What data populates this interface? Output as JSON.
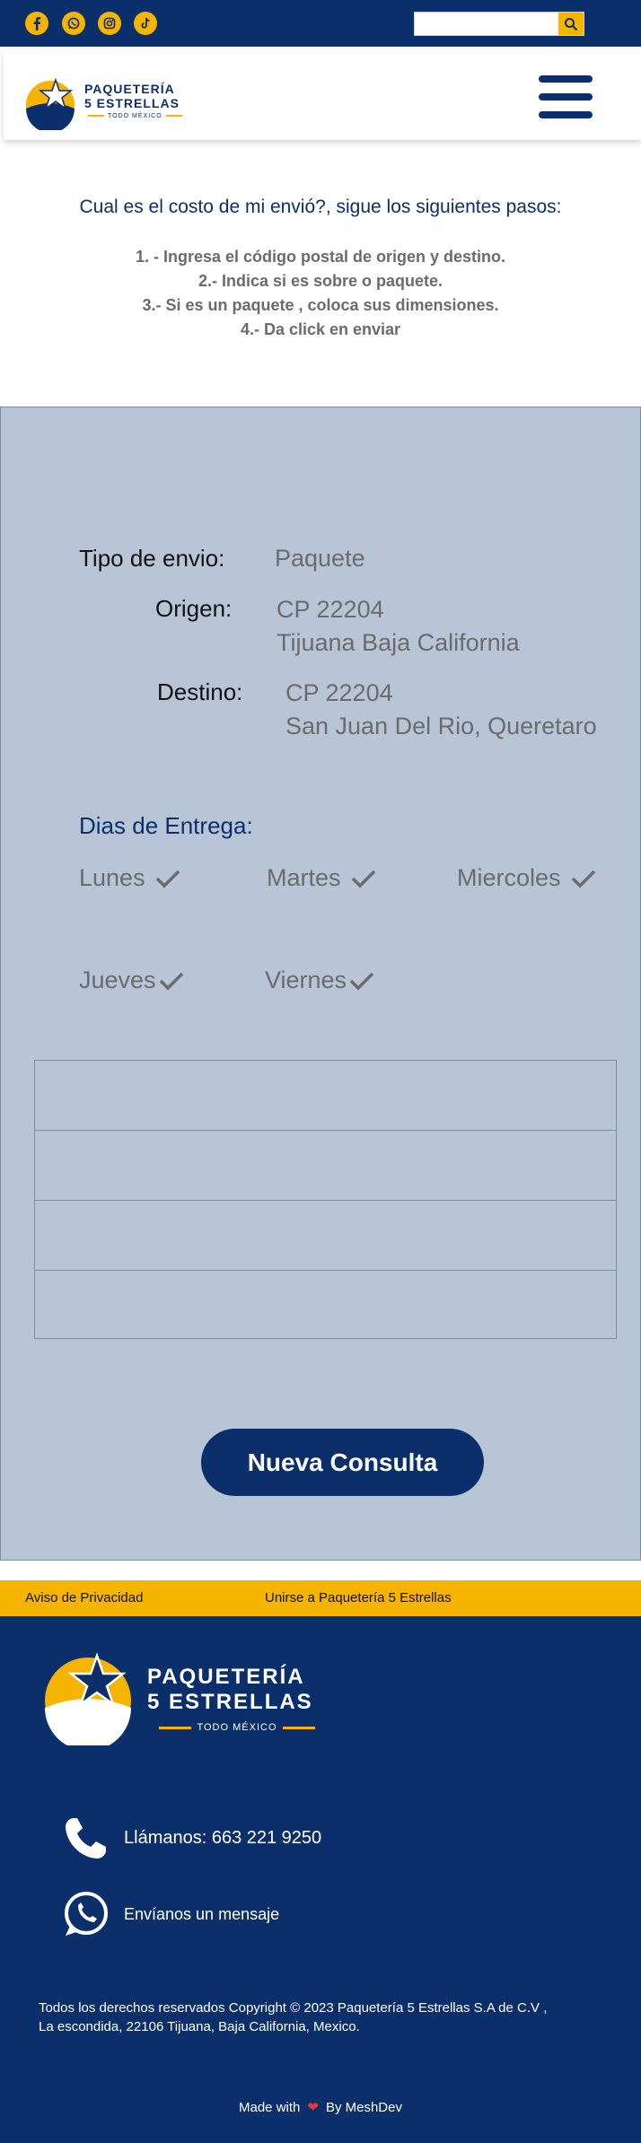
{
  "search": {
    "placeholder": "",
    "button_icon": "search-icon"
  },
  "social": [
    "facebook-icon",
    "whatsapp-icon",
    "instagram-icon",
    "tiktok-icon"
  ],
  "brand": {
    "name_line1": "PAQUETERÍA",
    "name_line2": "5 ESTRELLAS",
    "tagline": "TODO MÉXICO"
  },
  "intro": {
    "title": "Cual es el costo de mi envió?, sigue los siguientes pasos:",
    "steps": [
      "1. -  Ingresa el código postal de origen y destino.",
      "2.-  Indica si es sobre o paquete.",
      "3.-  Si es un paquete , coloca sus dimensiones.",
      "4.- Da click en enviar"
    ]
  },
  "shipment": {
    "type_label": "Tipo de envio:",
    "type_value": "Paquete",
    "origin_label": "Origen:",
    "origin_cp": "CP 22204",
    "origin_city": "Tijuana Baja California",
    "dest_label": "Destino:",
    "dest_cp": "CP 22204",
    "dest_city": "San Juan Del Rio, Queretaro"
  },
  "delivery": {
    "title": "Dias de Entrega:",
    "days": [
      "Lunes",
      "Martes",
      "Miercoles",
      "Jueves",
      "Viernes"
    ]
  },
  "rates_rows": 4,
  "new_query_label": "Nueva Consulta",
  "links": {
    "privacy": "Aviso de Privacidad",
    "join": "Unirse a Paquetería 5 Estrellas"
  },
  "footer": {
    "phone": "Llámanos: 663 221 9250",
    "message": "Envíanos un mensaje",
    "copyright_line1": "Todos los derechos reservados Copyright © 2023 Paquetería 5  Estrellas S.A de C.V ,",
    "copyright_line2": "La escondida, 22106 Tijuana, Baja California, Mexico.",
    "made_with": "Made with",
    "by": "By MeshDev"
  },
  "colors": {
    "navy": "#0b2f6b",
    "yellow": "#f5b400",
    "panel": "#b8c5d6",
    "heart": "#e53935"
  }
}
